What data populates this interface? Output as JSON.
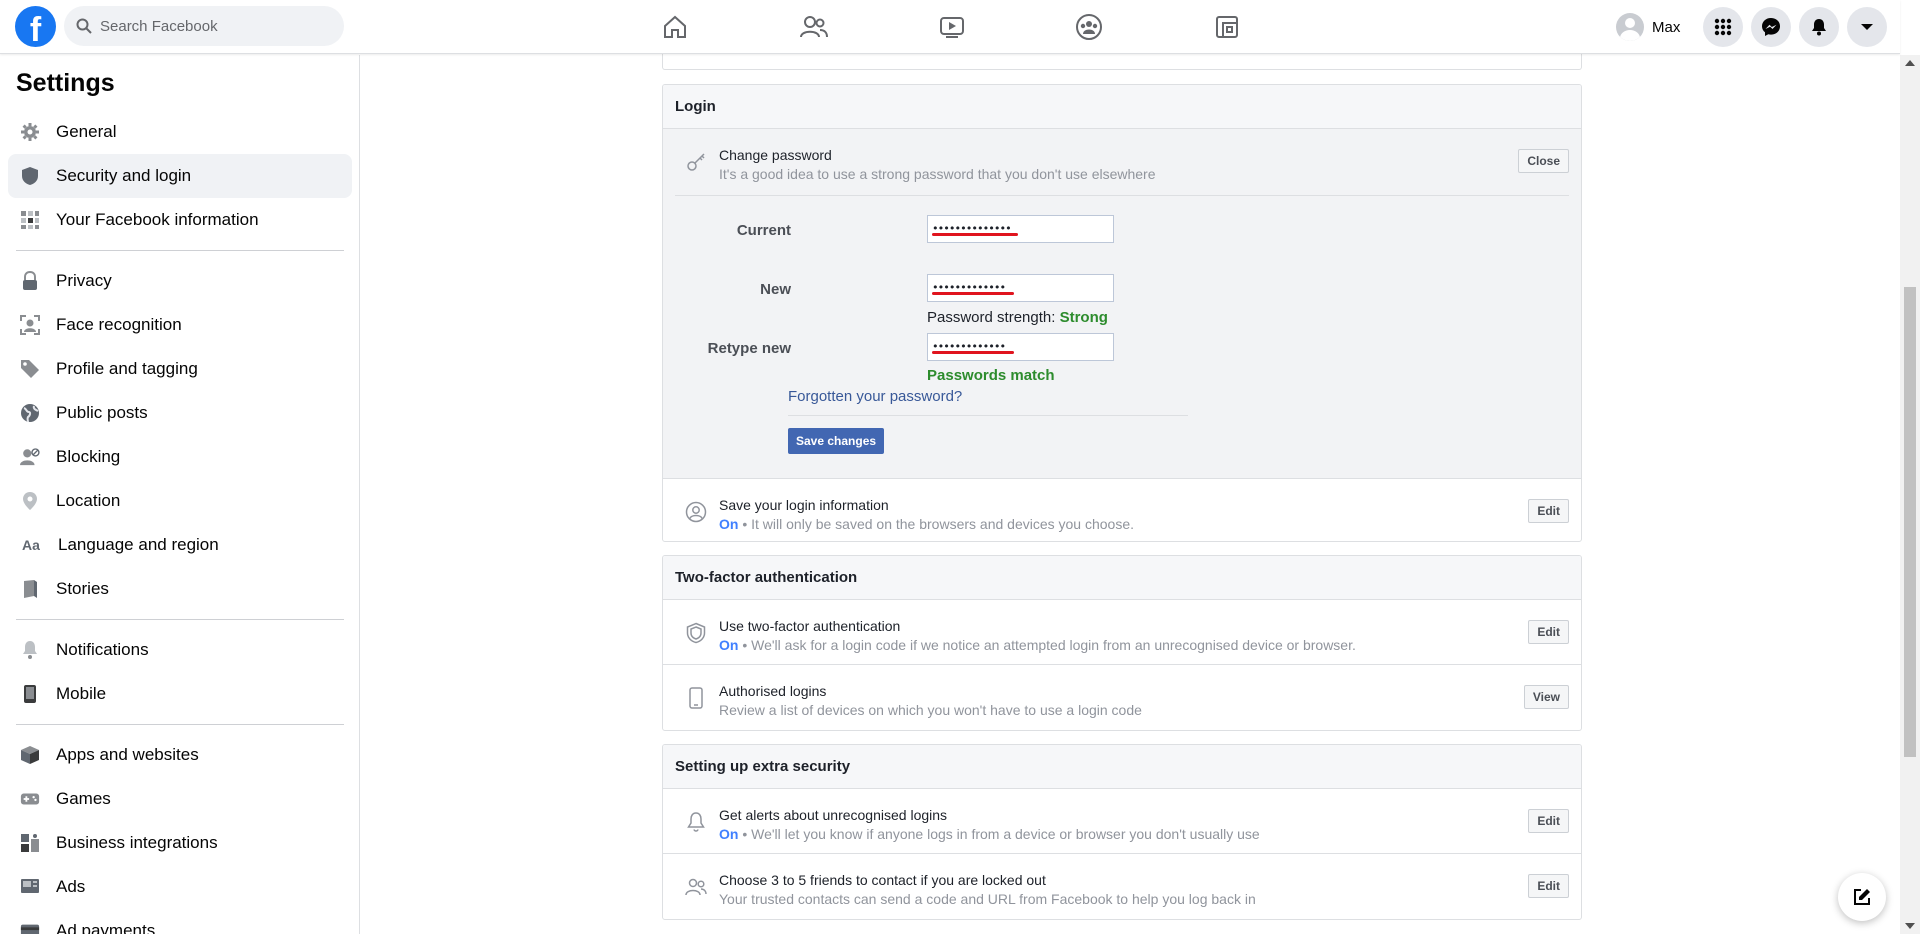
{
  "topbar": {
    "search_placeholder": "Search Facebook",
    "profile_name": "Max",
    "nav": [
      "home-icon",
      "friends-icon",
      "watch-icon",
      "groups-icon",
      "gaming-icon"
    ],
    "accent": "#1877f2"
  },
  "sidebar": {
    "title": "Settings",
    "items": [
      {
        "label": "General",
        "icon": "gear-icon"
      },
      {
        "label": "Security and login",
        "icon": "shield-icon",
        "active": true
      },
      {
        "label": "Your Facebook information",
        "icon": "grid-icon"
      },
      {
        "label": "Privacy",
        "icon": "lock-icon"
      },
      {
        "label": "Face recognition",
        "icon": "face-icon"
      },
      {
        "label": "Profile and tagging",
        "icon": "tag-icon"
      },
      {
        "label": "Public posts",
        "icon": "globe-icon"
      },
      {
        "label": "Blocking",
        "icon": "block-user-icon"
      },
      {
        "label": "Location",
        "icon": "location-pin-icon"
      },
      {
        "label": "Language and region",
        "icon": "language-icon"
      },
      {
        "label": "Stories",
        "icon": "book-icon"
      },
      {
        "label": "Notifications",
        "icon": "bell-icon"
      },
      {
        "label": "Mobile",
        "icon": "phone-icon"
      },
      {
        "label": "Apps and websites",
        "icon": "cube-icon"
      },
      {
        "label": "Games",
        "icon": "gamepad-icon"
      },
      {
        "label": "Business integrations",
        "icon": "business-icon"
      },
      {
        "label": "Ads",
        "icon": "ads-icon"
      },
      {
        "label": "Ad payments",
        "icon": "card-icon"
      }
    ]
  },
  "login": {
    "title": "Login",
    "change_password": {
      "title": "Change password",
      "subtitle": "It's a good idea to use a strong password that you don't use elsewhere",
      "close_label": "Close",
      "current_label": "Current",
      "current_value": "••••••••••••••",
      "new_label": "New",
      "new_value": "•••••••••••••",
      "strength_label": "Password strength:",
      "strength_value": "Strong",
      "retype_label": "Retype new",
      "retype_value": "•••••••••••••",
      "match_text": "Passwords match",
      "forgot_label": "Forgotten your password?",
      "save_label": "Save changes"
    },
    "save_login": {
      "title": "Save your login information",
      "status": "On",
      "desc": " • It will only be saved on the browsers and devices you choose.",
      "button": "Edit"
    }
  },
  "two_factor": {
    "title": "Two-factor authentication",
    "use_2fa": {
      "title": "Use two-factor authentication",
      "status": "On",
      "desc": " • We'll ask for a login code if we notice an attempted login from an unrecognised device or browser.",
      "button": "Edit"
    },
    "authorised": {
      "title": "Authorised logins",
      "desc": "Review a list of devices on which you won't have to use a login code",
      "button": "View"
    }
  },
  "extra_security": {
    "title": "Setting up extra security",
    "alerts": {
      "title": "Get alerts about unrecognised logins",
      "status": "On",
      "desc": " • We'll let you know if anyone logs in from a device or browser you don't usually use",
      "button": "Edit"
    },
    "friends": {
      "title": "Choose 3 to 5 friends to contact if you are locked out",
      "desc": "Your trusted contacts can send a code and URL from Facebook to help you log back in",
      "button": "Edit"
    }
  }
}
